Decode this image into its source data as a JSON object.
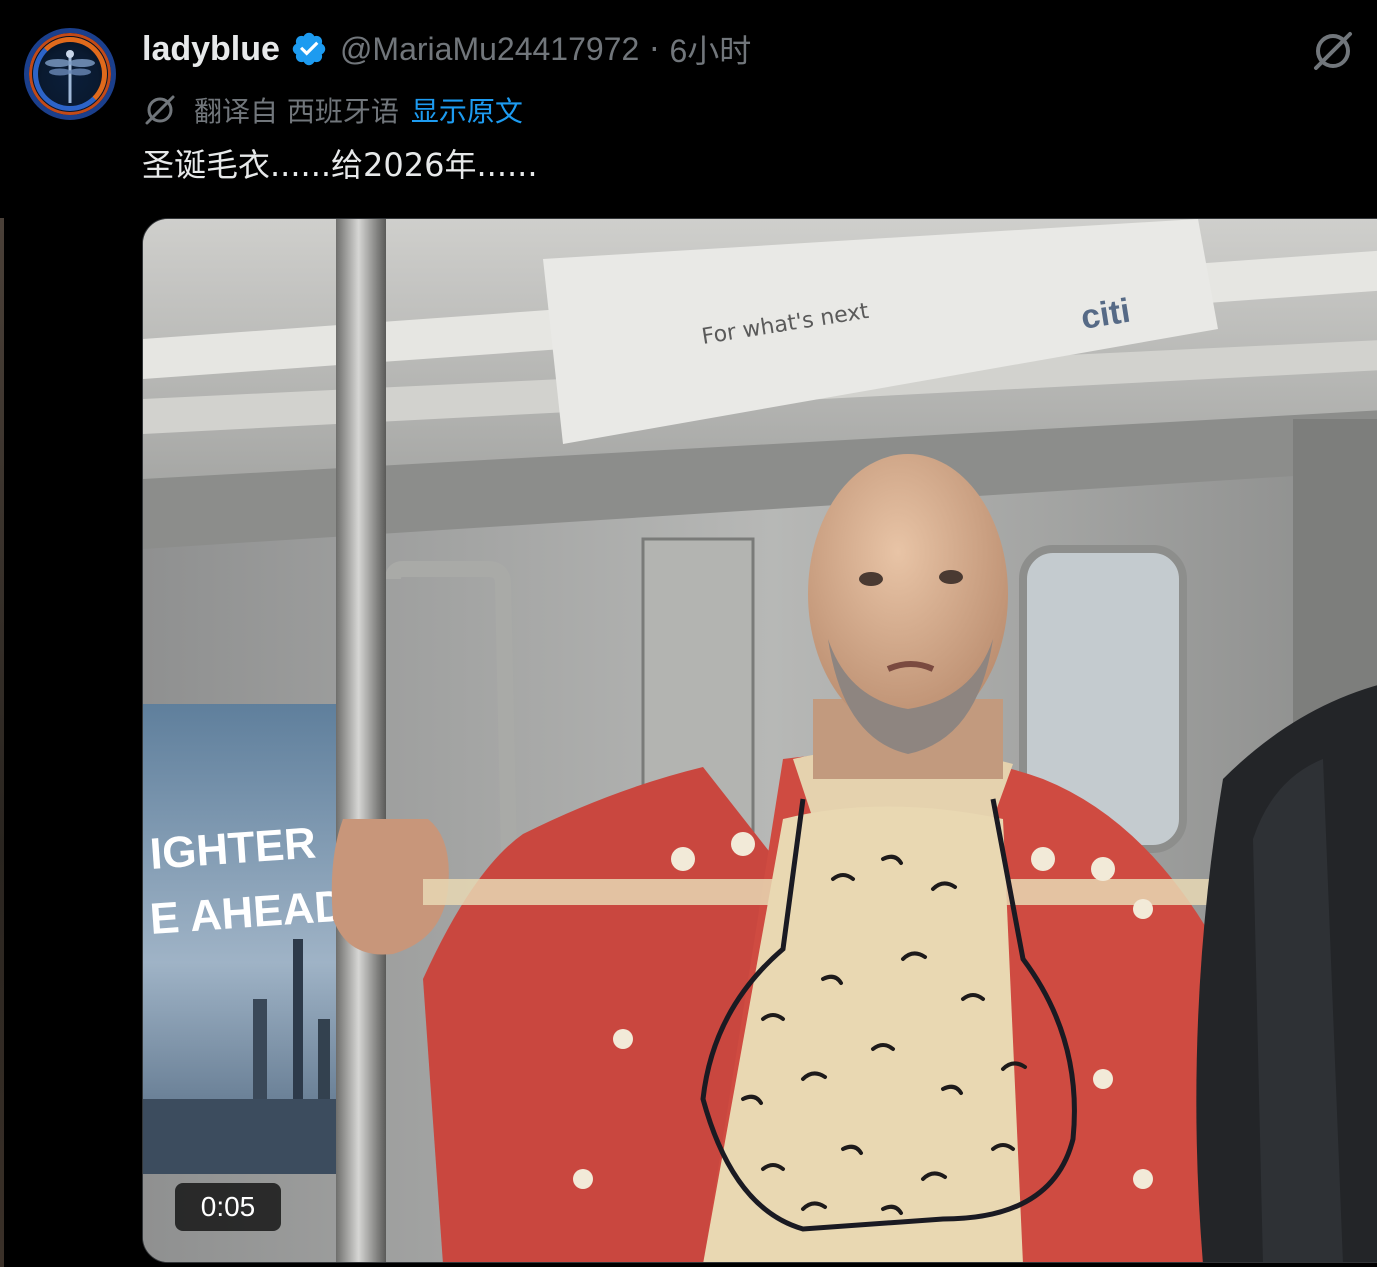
{
  "tweet": {
    "display_name": "ladyblue",
    "verified": true,
    "handle": "@MariaMu24417972",
    "separator": "·",
    "time": "6小时",
    "translated_from": "翻译自 西班牙语",
    "show_original": "显示原文",
    "text": "圣诞毛衣......给2026年......"
  },
  "media": {
    "type": "video",
    "duration": "0:05",
    "ad_text_top": "For what's next",
    "ad_brand": "citi",
    "poster_line1": "IGHTER",
    "poster_line2": "E AHEAD"
  },
  "icons": {
    "more": "grok-slash-icon",
    "translate": "grok-slash-icon",
    "verified": "verified-badge-icon"
  },
  "colors": {
    "background": "#000000",
    "text_primary": "#e7e9ea",
    "text_secondary": "#71767b",
    "link": "#1d9bf0",
    "verified": "#1d9bf0"
  }
}
